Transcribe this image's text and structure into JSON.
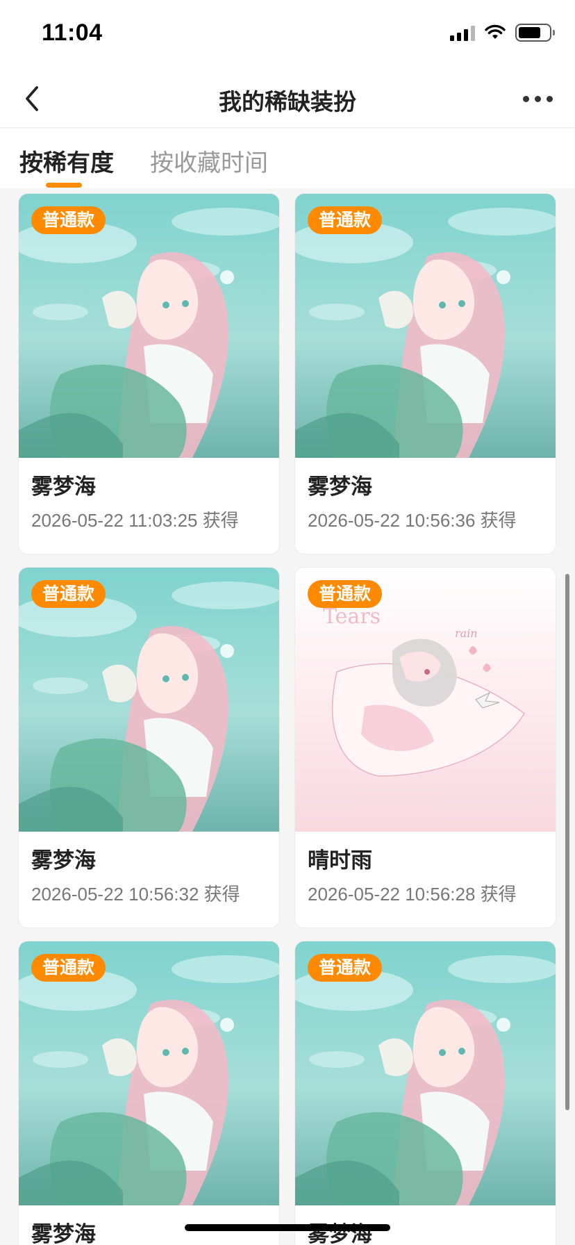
{
  "status_bar": {
    "time": "11:04",
    "icons": [
      "cellular-signal-icon",
      "wifi-icon",
      "battery-icon"
    ]
  },
  "nav": {
    "back_icon": "chevron-left-icon",
    "title": "我的稀缺装扮",
    "more_icon": "more-dots-icon"
  },
  "tabs": [
    {
      "label": "按稀有度",
      "active": true
    },
    {
      "label": "按收藏时间",
      "active": false
    }
  ],
  "colors": {
    "accent": "#ff8a00",
    "card_bg": "#ffffff",
    "page_bg": "#f5f5f5",
    "text_primary": "#222222",
    "text_secondary": "#777777"
  },
  "cards": [
    {
      "badge": "普通款",
      "name": "雾梦海",
      "time": "2026-05-22 11:03:25 获得",
      "theme": "mermaid-teal"
    },
    {
      "badge": "普通款",
      "name": "雾梦海",
      "time": "2026-05-22 10:56:36 获得",
      "theme": "mermaid-teal"
    },
    {
      "badge": "普通款",
      "name": "雾梦海",
      "time": "2026-05-22 10:56:32 获得",
      "theme": "mermaid-teal"
    },
    {
      "badge": "普通款",
      "name": "晴时雨",
      "time": "2026-05-22 10:56:28 获得",
      "theme": "pink-rain"
    },
    {
      "badge": "普通款",
      "name": "雾梦海",
      "time": "",
      "theme": "mermaid-teal"
    },
    {
      "badge": "普通款",
      "name": "雾梦海",
      "time": "",
      "theme": "mermaid-teal"
    }
  ]
}
